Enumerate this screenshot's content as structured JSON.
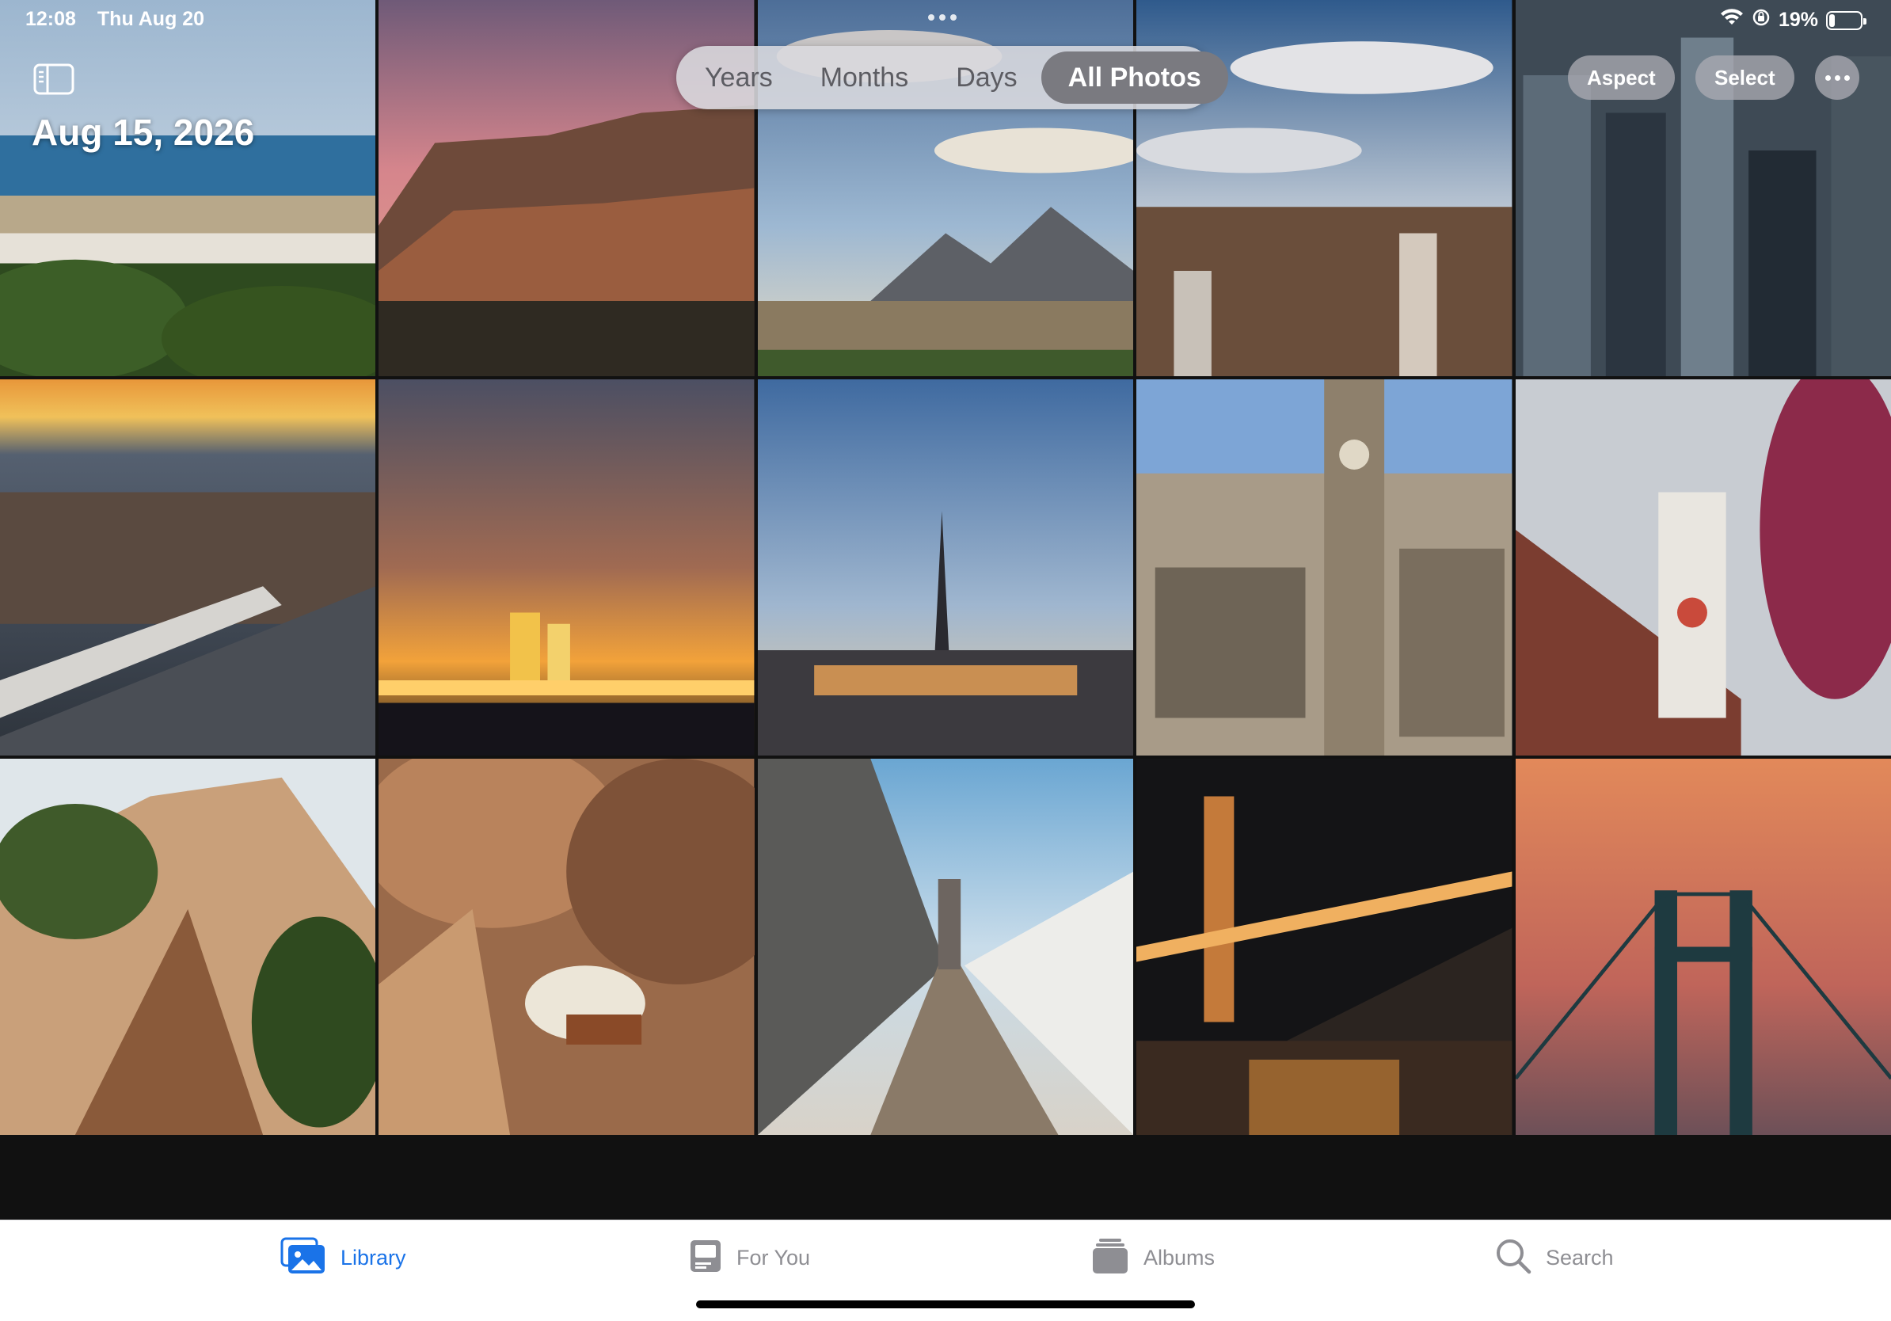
{
  "status_bar": {
    "time": "12:08",
    "date": "Thu Aug 20",
    "battery": "19%",
    "battery_level_percent": 19,
    "icons": [
      "wifi-icon",
      "orientation-lock-icon",
      "battery-icon"
    ]
  },
  "header": {
    "date_heading": "Aug 15, 2026",
    "segments": [
      {
        "label": "Years",
        "active": false
      },
      {
        "label": "Months",
        "active": false
      },
      {
        "label": "Days",
        "active": false
      },
      {
        "label": "All Photos",
        "active": true
      }
    ],
    "aspect_label": "Aspect",
    "select_label": "Select",
    "more_icon": "ellipsis-icon",
    "sidebar_icon": "sidebar-toggle-icon"
  },
  "photos": [
    "coastal-town",
    "cliff-sunset",
    "city-mountains",
    "city-aerial",
    "skyscrapers",
    "rooftops-sunset",
    "bay-bridge-night",
    "church-spire-skyline",
    "gothic-town-hall",
    "clock-tower",
    "sandstone-cliffs",
    "canyon-yurt",
    "bridge-walkway",
    "golden-gate-night",
    "bridge-silhouette"
  ],
  "tab_bar": {
    "tabs": [
      {
        "label": "Library",
        "icon": "photo-library-icon",
        "active": true
      },
      {
        "label": "For You",
        "icon": "for-you-icon",
        "active": false
      },
      {
        "label": "Albums",
        "icon": "albums-icon",
        "active": false
      },
      {
        "label": "Search",
        "icon": "search-icon",
        "active": false
      }
    ]
  },
  "colors": {
    "accent": "#1a73e8",
    "tab_inactive": "#8e8e93",
    "segment_active_bg": "#7a7a80"
  }
}
